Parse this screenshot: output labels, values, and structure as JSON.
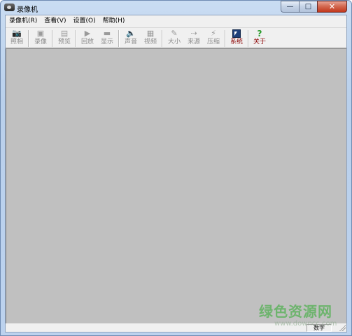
{
  "window": {
    "title": "录像机",
    "controls": {
      "minimize": "—",
      "maximize": "□",
      "close": "✕"
    }
  },
  "menubar": {
    "items": [
      {
        "label": "录像机(R)"
      },
      {
        "label": "查看(V)"
      },
      {
        "label": "设置(O)"
      },
      {
        "label": "帮助(H)"
      }
    ]
  },
  "toolbar": {
    "buttons": [
      {
        "label": "照相",
        "icon": "camera-icon",
        "glyph": "📷",
        "enabled": false
      },
      {
        "label": "录像",
        "icon": "video-camera-icon",
        "glyph": "▣",
        "enabled": false
      },
      {
        "label": "预览",
        "icon": "monitor-icon",
        "glyph": "▤",
        "enabled": false
      },
      {
        "label": "回放",
        "icon": "play-icon",
        "glyph": "▶",
        "enabled": false
      },
      {
        "label": "显示",
        "icon": "display-icon",
        "glyph": "▬",
        "enabled": false
      },
      {
        "label": "声音",
        "icon": "speaker-icon",
        "glyph": "🔈",
        "enabled": false
      },
      {
        "label": "视频",
        "icon": "film-icon",
        "glyph": "▦",
        "enabled": false
      },
      {
        "label": "大小",
        "icon": "resize-icon",
        "glyph": "✎",
        "enabled": false
      },
      {
        "label": "来源",
        "icon": "source-icon",
        "glyph": "⇢",
        "enabled": false
      },
      {
        "label": "压缩",
        "icon": "compress-icon",
        "glyph": "⚡",
        "enabled": false
      },
      {
        "label": "系统",
        "icon": "system-icon",
        "glyph": "",
        "enabled": true
      },
      {
        "label": "关于",
        "icon": "help-icon",
        "glyph": "?",
        "enabled": true
      }
    ]
  },
  "statusbar": {
    "panel_text": "数字"
  },
  "watermark": {
    "text": "绿色资源网",
    "sub": "www.downcc.com"
  },
  "colors": {
    "main_area": "#c0c0c0",
    "active_label": "#8b0000",
    "disabled_label": "#8c8c8c",
    "close_button": "#c2371b"
  }
}
